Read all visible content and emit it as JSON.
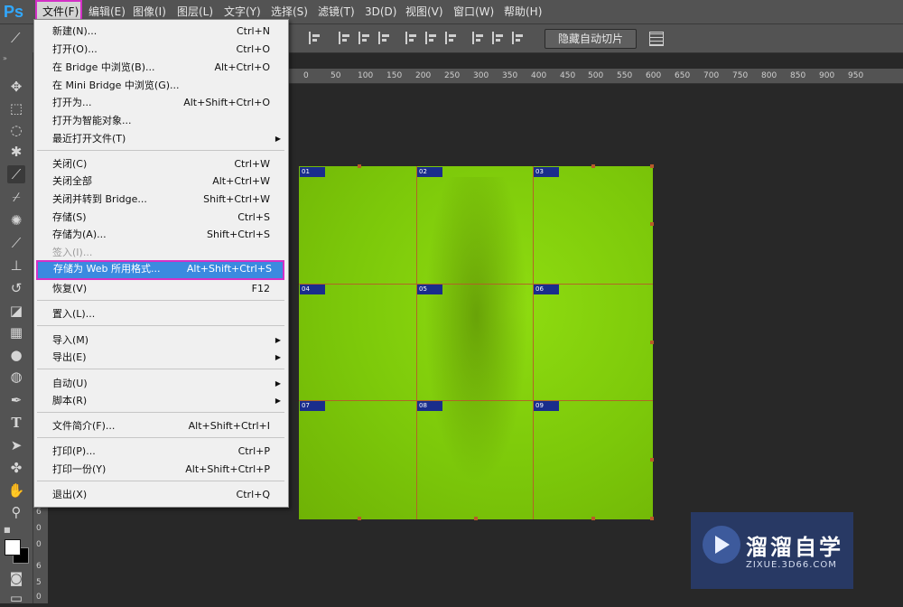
{
  "app": {
    "logo_text": "Ps"
  },
  "menubar": [
    {
      "label": "文件(F)",
      "active": true
    },
    {
      "label": "编辑(E)"
    },
    {
      "label": "图像(I)"
    },
    {
      "label": "图层(L)"
    },
    {
      "label": "文字(Y)"
    },
    {
      "label": "选择(S)"
    },
    {
      "label": "滤镜(T)"
    },
    {
      "label": "3D(D)"
    },
    {
      "label": "视图(V)"
    },
    {
      "label": "窗口(W)"
    },
    {
      "label": "帮助(H)"
    }
  ],
  "options_bar": {
    "hide_auto_slices_label": "隐藏自动切片"
  },
  "file_menu": {
    "items": [
      {
        "label": "新建(N)...",
        "shortcut": "Ctrl+N"
      },
      {
        "label": "打开(O)...",
        "shortcut": "Ctrl+O"
      },
      {
        "label": "在 Bridge 中浏览(B)...",
        "shortcut": "Alt+Ctrl+O"
      },
      {
        "label": "在 Mini Bridge 中浏览(G)...",
        "shortcut": ""
      },
      {
        "label": "打开为...",
        "shortcut": "Alt+Shift+Ctrl+O"
      },
      {
        "label": "打开为智能对象...",
        "shortcut": ""
      },
      {
        "label": "最近打开文件(T)",
        "shortcut": "",
        "submenu": true
      },
      {
        "label": "关闭(C)",
        "shortcut": "Ctrl+W"
      },
      {
        "label": "关闭全部",
        "shortcut": "Alt+Ctrl+W"
      },
      {
        "label": "关闭并转到 Bridge...",
        "shortcut": "Shift+Ctrl+W"
      },
      {
        "label": "存储(S)",
        "shortcut": "Ctrl+S"
      },
      {
        "label": "存储为(A)...",
        "shortcut": "Shift+Ctrl+S"
      },
      {
        "label": "签入(I)...",
        "shortcut": "",
        "disabled": true
      },
      {
        "label": "存储为 Web 所用格式...",
        "shortcut": "Alt+Shift+Ctrl+S",
        "highlighted": true
      },
      {
        "label": "恢复(V)",
        "shortcut": "F12"
      },
      {
        "label": "置入(L)...",
        "shortcut": ""
      },
      {
        "label": "导入(M)",
        "shortcut": "",
        "submenu": true
      },
      {
        "label": "导出(E)",
        "shortcut": "",
        "submenu": true
      },
      {
        "label": "自动(U)",
        "shortcut": "",
        "submenu": true
      },
      {
        "label": "脚本(R)",
        "shortcut": "",
        "submenu": true
      },
      {
        "label": "文件简介(F)...",
        "shortcut": "Alt+Shift+Ctrl+I"
      },
      {
        "label": "打印(P)...",
        "shortcut": "Ctrl+P"
      },
      {
        "label": "打印一份(Y)",
        "shortcut": "Alt+Shift+Ctrl+P"
      },
      {
        "label": "退出(X)",
        "shortcut": "Ctrl+Q"
      }
    ]
  },
  "ruler": {
    "top_ticks": [
      "0",
      "50",
      "100",
      "150",
      "200",
      "250",
      "300",
      "350",
      "400",
      "450",
      "500",
      "550",
      "600",
      "650",
      "700",
      "750",
      "800",
      "850",
      "900",
      "950"
    ],
    "left_ticks": [
      "6",
      "0",
      "0",
      "6",
      "5",
      "0"
    ]
  },
  "slices": [
    "01",
    "02",
    "03",
    "04",
    "05",
    "06",
    "07",
    "08",
    "09"
  ],
  "watermark": {
    "title": "溜溜自学",
    "url": "ZIXUE.3D66.COM"
  },
  "colors": {
    "menu_highlight": "#3b8ae0",
    "annotation_border": "#d330c6",
    "slice_line": "#b85a2a",
    "canvas_tint": "#7cc80a"
  }
}
